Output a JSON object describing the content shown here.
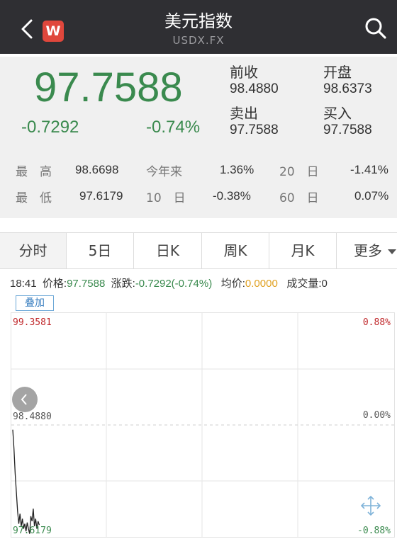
{
  "header": {
    "title": "美元指数",
    "subtitle": "USDX.FX",
    "logo_text": "W"
  },
  "quote": {
    "price": "97.7588",
    "change": "-0.7292",
    "change_pct": "-0.74%",
    "prev_close_label": "前收",
    "prev_close": "98.4880",
    "open_label": "开盘",
    "open": "98.6373",
    "ask_label": "卖出",
    "ask": "97.7588",
    "bid_label": "买入",
    "bid": "97.7588"
  },
  "stats": {
    "high_label": "最　高",
    "high": "98.6698",
    "low_label": "最　低",
    "low": "97.6179",
    "ytd_label": "今年来",
    "ytd": "1.36%",
    "d10_label": "10　日",
    "d10": "-0.38%",
    "d20_label": "20　日",
    "d20": "-1.41%",
    "d60_label": "60　日",
    "d60": "0.07%"
  },
  "tabs": [
    "分时",
    "5日",
    "日K",
    "周K",
    "月K",
    "更多"
  ],
  "inforow": {
    "time": "18:41",
    "price_label": "价格:",
    "price": "97.7588",
    "change_label": "涨跌:",
    "change": "-0.7292(-0.74%)",
    "avg_label": "均价:",
    "avg": "0.0000",
    "volume_label": "成交量:",
    "volume": "0"
  },
  "overlay_label": "叠加",
  "chart_data": {
    "type": "line",
    "y_left_ticks": [
      "99.3581",
      "98.4880",
      "97.6179"
    ],
    "y_right_ticks": [
      "0.88%",
      "0.00%",
      "-0.88%"
    ],
    "ylim": [
      97.6179,
      99.3581
    ],
    "baseline": 98.488,
    "series": [
      {
        "values": [
          98.45,
          98.3,
          98.1,
          97.95,
          97.8,
          97.7,
          97.78,
          97.68,
          97.74,
          97.66,
          97.7,
          97.64,
          97.71,
          97.66,
          97.62,
          97.76,
          97.72,
          97.82,
          97.68,
          97.74,
          97.66,
          97.72,
          97.69
        ]
      }
    ]
  },
  "colors": {
    "down": "#3a8a4e",
    "up": "#c0282b",
    "header_bg": "#2f2f33",
    "logo_bg": "#e0473c",
    "avg_price": "#e0a020"
  },
  "icons": {
    "back": "chevron-left-icon",
    "search": "search-icon",
    "scroll_left": "chevron-left-circle-icon",
    "expand": "expand-arrows-icon"
  }
}
